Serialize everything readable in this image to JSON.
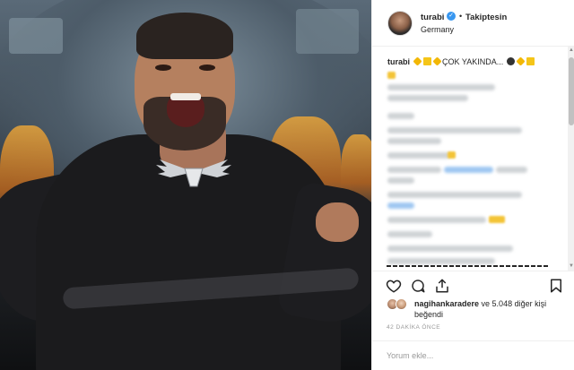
{
  "post": {
    "username": "turabi",
    "verified_symbol": "✓",
    "separator": "•",
    "follow_status": "Takiptesin",
    "location": "Germany",
    "caption_username": "turabi",
    "caption_text": "ÇOK YAKINDA...",
    "likes_username": "nagihankaradere",
    "likes_rest": "ve 5.048 diğer kişi beğendi",
    "timestamp": "42 DAKİKA ÖNCE",
    "comment_placeholder": "Yorum ekle..."
  },
  "icons": {
    "verified": "verified-badge-icon",
    "like": "heart-icon",
    "comment": "speech-bubble-icon",
    "share": "share-icon",
    "save": "bookmark-icon"
  },
  "colors": {
    "verified_blue": "#3897f0",
    "text": "#262626",
    "muted": "#999999",
    "border": "#efefef"
  }
}
